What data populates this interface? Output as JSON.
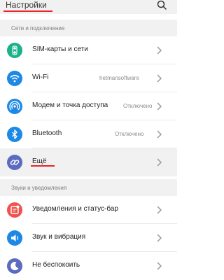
{
  "header": {
    "title": "Настройки"
  },
  "sections": {
    "network": "Сети и подключение",
    "sound": "Звуки и уведомления"
  },
  "rows": {
    "sim": {
      "label": "SIM-карты и сети",
      "icon": "sim-icon",
      "color": "#1bb28b"
    },
    "wifi": {
      "label": "Wi-Fi",
      "value": "hetmansoftware",
      "icon": "wifi-icon",
      "color": "#1e88e5"
    },
    "hotspot": {
      "label": "Модем и точка доступа",
      "value": "Отключено",
      "icon": "hotspot-icon",
      "color": "#1e88e5"
    },
    "bluetooth": {
      "label": "Bluetooth",
      "value": "Отключено",
      "icon": "bluetooth-icon",
      "color": "#1e88e5"
    },
    "more": {
      "label": "Ещё",
      "icon": "link-icon",
      "color": "#5c6bc0"
    },
    "notifications": {
      "label": "Уведомления и статус-бар",
      "icon": "notification-icon",
      "color": "#ef5350"
    },
    "sound": {
      "label": "Звук и вибрация",
      "icon": "sound-icon",
      "color": "#1e88e5"
    },
    "dnd": {
      "label": "Не беспокоить",
      "icon": "moon-icon",
      "color": "#5c6bc0"
    }
  },
  "colors": {
    "accent": "#e8242d"
  }
}
